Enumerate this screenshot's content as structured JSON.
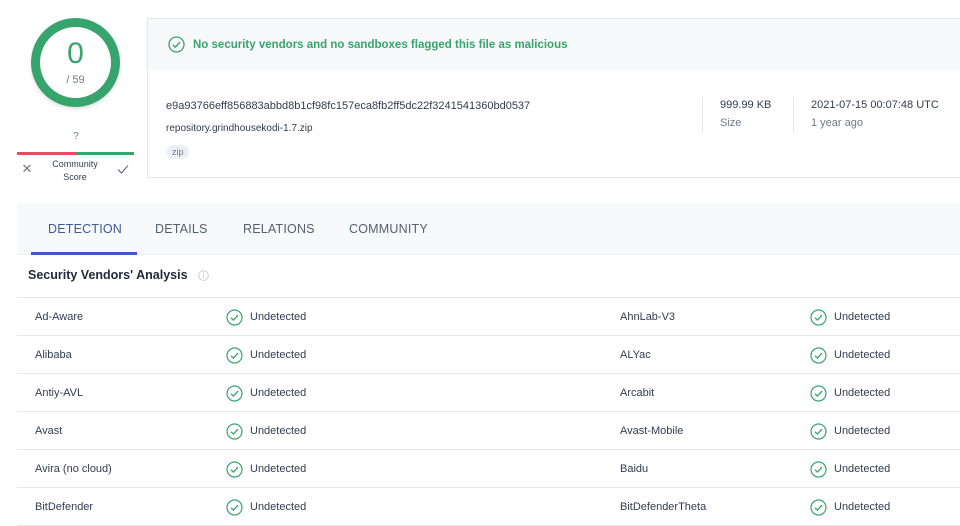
{
  "score": {
    "detections": "0",
    "total": "/ 59",
    "ring_color": "#36a46c"
  },
  "community_score": {
    "value": "?",
    "label_line1": "Community",
    "label_line2": "Score",
    "downvote_icon": "close-icon",
    "upvote_icon": "check-icon"
  },
  "banner": {
    "icon": "check-circle-icon",
    "text": "No security vendors and no sandboxes flagged this file as malicious",
    "color": "#36a46c"
  },
  "file": {
    "hash": "e9a93766eff856883abbd8b1cf98fc157eca8fb2ff5dc22f3241541360bd0537",
    "name": "repository.grindhousekodi-1.7.zip",
    "tag": "zip",
    "size_value": "999.99 KB",
    "size_label": "Size",
    "date_value": "2021-07-15 00:07:48 UTC",
    "date_ago": "1 year ago"
  },
  "tabs": [
    {
      "label": "DETECTION",
      "active": true
    },
    {
      "label": "DETAILS",
      "active": false
    },
    {
      "label": "RELATIONS",
      "active": false
    },
    {
      "label": "COMMUNITY",
      "active": false
    }
  ],
  "section": {
    "title": "Security Vendors' Analysis",
    "info_icon": "info-icon"
  },
  "vendors": [
    {
      "left": {
        "name": "Ad-Aware",
        "status": "Undetected"
      },
      "right": {
        "name": "AhnLab-V3",
        "status": "Undetected"
      }
    },
    {
      "left": {
        "name": "Alibaba",
        "status": "Undetected"
      },
      "right": {
        "name": "ALYac",
        "status": "Undetected"
      }
    },
    {
      "left": {
        "name": "Antiy-AVL",
        "status": "Undetected"
      },
      "right": {
        "name": "Arcabit",
        "status": "Undetected"
      }
    },
    {
      "left": {
        "name": "Avast",
        "status": "Undetected"
      },
      "right": {
        "name": "Avast-Mobile",
        "status": "Undetected"
      }
    },
    {
      "left": {
        "name": "Avira (no cloud)",
        "status": "Undetected"
      },
      "right": {
        "name": "Baidu",
        "status": "Undetected"
      }
    },
    {
      "left": {
        "name": "BitDefender",
        "status": "Undetected"
      },
      "right": {
        "name": "BitDefenderTheta",
        "status": "Undetected"
      }
    }
  ]
}
